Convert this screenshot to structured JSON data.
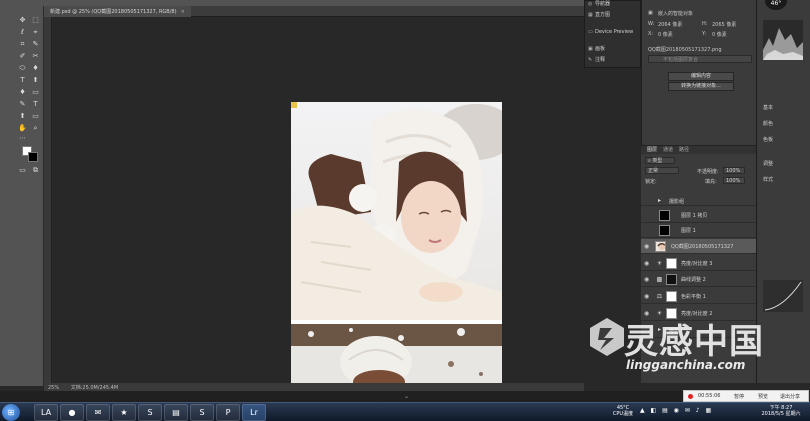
{
  "document": {
    "tab_title": "新建.psd @ 25% (QQ截图20180505171327, RGB/8)",
    "close_glyph": "×"
  },
  "float_panel": {
    "items": [
      {
        "icon": "navigator-icon",
        "label": "导航器"
      },
      {
        "icon": "histogram-icon",
        "label": "直方图"
      },
      {
        "icon": "device-preview-icon",
        "label": "Device Preview"
      },
      {
        "icon": "artboard-icon",
        "label": "画板"
      },
      {
        "icon": "notes-icon",
        "label": "注释"
      }
    ]
  },
  "properties": {
    "header": "嵌入的智能对象",
    "width_label": "W:",
    "width_value": "2064 像素",
    "height_label": "H:",
    "height_value": "2065 像素",
    "x_label": "X:",
    "x_value": "0 像素",
    "y_label": "Y:",
    "y_value": "0 像素",
    "file_name": "QQ截图20180505171327.png",
    "placeholder": "不包括图层复合",
    "edit_button": "编辑内容",
    "convert_button": "转换为链接对象..."
  },
  "right_column": {
    "weather": "46°",
    "items": [
      "基本",
      "颜色",
      "色板",
      "调整",
      "样式"
    ]
  },
  "layers": {
    "tabs": [
      "图层",
      "通道",
      "路径"
    ],
    "filter_label": "类型",
    "blend_mode": "正常",
    "opacity_label": "不透明度:",
    "opacity_value": "100%",
    "lock_label": "锁定:",
    "fill_label": "填充:",
    "fill_value": "100%",
    "rows": [
      {
        "name": "摄影组",
        "kind": "group",
        "visible": false
      },
      {
        "name": "图层 1 拷贝",
        "kind": "black",
        "visible": false
      },
      {
        "name": "图层 1",
        "kind": "black",
        "visible": false
      },
      {
        "name": "QQ截图20180505171327",
        "kind": "photo",
        "visible": true
      },
      {
        "name": "亮度/对比度 3",
        "kind": "adjust",
        "visible": true
      },
      {
        "name": "曲线调整 2",
        "kind": "adjust",
        "visible": true
      },
      {
        "name": "色彩平衡 1",
        "kind": "adjust",
        "visible": true
      },
      {
        "name": "亮度/对比度 2",
        "kind": "adjust",
        "visible": true
      }
    ],
    "group_name": "摄影",
    "icon_glyphs": {
      "eye": "◉",
      "folder": "▸",
      "adjust": "◐"
    }
  },
  "status_bar": {
    "zoom": "25%",
    "doc_size": "文档:25.0M/245.4M"
  },
  "watermark": {
    "cn": "灵感中国",
    "url": "lingganchina.com"
  },
  "recording": {
    "time": "00:55:06",
    "btn1": "暂停",
    "btn2": "预览",
    "btn3": "退出分享"
  },
  "taskbar": {
    "start_glyph": "⊞",
    "cpu_temp": "45°C",
    "cpu_label": "CPU温度",
    "time": "下午 8:27",
    "date": "2018/5/5 星期六",
    "buttons": [
      "LA",
      "●",
      "✉",
      "★",
      "S",
      "▤",
      "S",
      "P",
      "Lr"
    ]
  },
  "toolbar_glyphs": [
    "✥",
    "⬚",
    "ℓ",
    "⌖",
    "⌗",
    "✎",
    "✐",
    "✂",
    "⬭",
    "♦",
    "T",
    "⬆",
    "▭",
    "✋",
    "⌕",
    "⋯"
  ],
  "colors": {
    "foreground": "#ffffff",
    "background": "#000000",
    "accent_recording": "#e02020"
  }
}
